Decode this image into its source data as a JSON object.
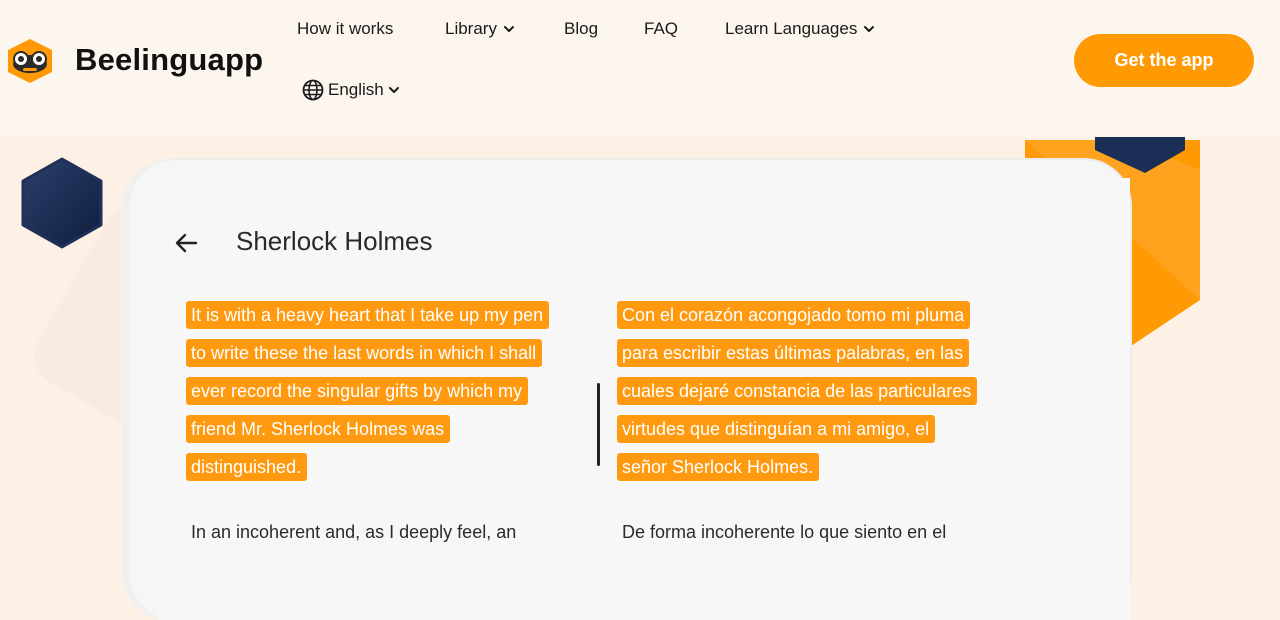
{
  "brand": {
    "name": "Beelinguapp"
  },
  "nav": {
    "items": [
      {
        "label": "How it works",
        "dropdown": false
      },
      {
        "label": "Library",
        "dropdown": true
      },
      {
        "label": "Blog",
        "dropdown": false
      },
      {
        "label": "FAQ",
        "dropdown": false
      },
      {
        "label": "Learn Languages",
        "dropdown": true
      }
    ],
    "language": {
      "label": "English",
      "icon": "globe-icon"
    },
    "cta_label": "Get the app"
  },
  "colors": {
    "accent": "#ff9a05",
    "hex_dark": "#1b2e55",
    "background": "#fdf1e6"
  },
  "reader": {
    "title": "Sherlock Holmes",
    "back_icon": "arrow-left-icon",
    "left_lines": [
      "It is with a heavy heart that I take up my pen",
      "to write these the last words in which I shall",
      "ever record the singular gifts by which my",
      "friend Mr. Sherlock Holmes was",
      "distinguished."
    ],
    "right_lines": [
      "Con el corazón acongojado tomo mi pluma",
      "para escribir estas últimas palabras, en las",
      "cuales dejaré constancia de las particulares",
      "virtudes que distinguían a mi amigo, el",
      "señor Sherlock Holmes."
    ],
    "next_left": "In an incoherent and, as I deeply feel, an",
    "next_right": "De forma incoherente lo que siento en el"
  }
}
